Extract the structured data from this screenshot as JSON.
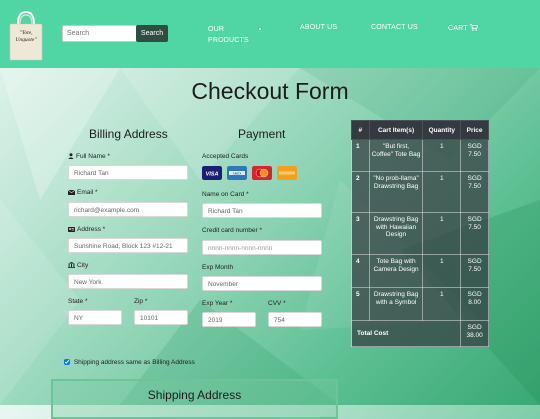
{
  "header": {
    "logo_text": "\"Tote, Unquote\"",
    "search": {
      "placeholder": "Search",
      "button_label": "Search"
    },
    "nav": {
      "products": "OUR PRODUCTS",
      "about": "ABOUT US",
      "contact": "CONTACT US",
      "cart": "CART"
    }
  },
  "page": {
    "title": "Checkout Form"
  },
  "billing": {
    "heading": "Billing Address",
    "full_name": {
      "label": "Full Name *",
      "value": "Richard Tan"
    },
    "email": {
      "label": "Email *",
      "value": "richard@example.com"
    },
    "address": {
      "label": "Address *",
      "value": "Sunshine Road, Block 123 #12-21"
    },
    "city": {
      "label": "City",
      "value": "New York"
    },
    "state": {
      "label": "State *",
      "value": "NY"
    },
    "zip": {
      "label": "Zip *",
      "value": "10101"
    }
  },
  "payment": {
    "heading": "Payment",
    "accepted_cards_label": "Accepted Cards",
    "cards": [
      "visa",
      "amex",
      "mastercard",
      "discover"
    ],
    "name_on_card": {
      "label": "Name on Card *",
      "value": "Richard Tan"
    },
    "card_number": {
      "label": "Credit card number *",
      "value": "nnnn-nnnn-nnnn-nnnn"
    },
    "exp_month": {
      "label": "Exp Month",
      "value": "November"
    },
    "exp_year": {
      "label": "Exp Year *",
      "value": "2019"
    },
    "cvv": {
      "label": "CVV *",
      "value": "754"
    }
  },
  "cart": {
    "headers": [
      "#",
      "Cart Item(s)",
      "Quantity",
      "Price"
    ],
    "rows": [
      {
        "num": "1",
        "item": "\"But first, Coffee\" Tote Bag",
        "qty": "1",
        "price": "SGD 7.50"
      },
      {
        "num": "2",
        "item": "\"No prob-llama\" Drawstring Bag",
        "qty": "1",
        "price": "SGD 7.50"
      },
      {
        "num": "3",
        "item": "Drawstring Bag with Hawaiian Design",
        "qty": "1",
        "price": "SGD 7.50"
      },
      {
        "num": "4",
        "item": "Tote Bag with Camera Design",
        "qty": "1",
        "price": "SGD 7.50"
      },
      {
        "num": "5",
        "item": "Drawstring Bag with a Symbol",
        "qty": "1",
        "price": "SGD 8.00"
      }
    ],
    "total_label": "Total Cost",
    "total_value": "SGD 38.00"
  },
  "same_address": {
    "label": "Shipping address same as Billing Address",
    "checked": true
  },
  "shipping": {
    "heading": "Shipping Address"
  },
  "colors": {
    "header_bg": "#4fd6a4",
    "search_button": "#2f4d40",
    "table_header": "#343a40"
  }
}
